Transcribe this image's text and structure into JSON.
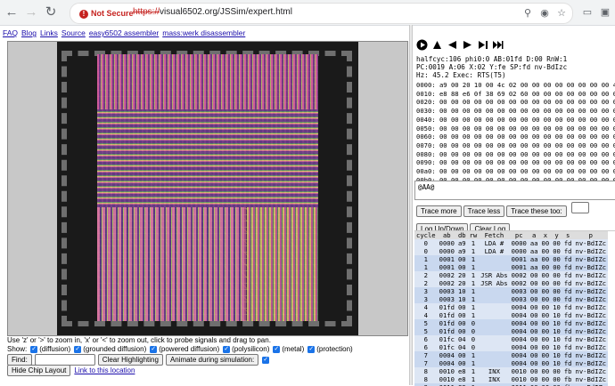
{
  "browser": {
    "security_label": "Not Secure",
    "url_scheme": "https://",
    "url_rest": "visual6502.org/JSSim/expert.html"
  },
  "top_links": [
    {
      "name": "link-faq",
      "label": "FAQ"
    },
    {
      "name": "link-blog",
      "label": "Blog"
    },
    {
      "name": "link-links",
      "label": "Links"
    },
    {
      "name": "link-source",
      "label": "Source"
    },
    {
      "name": "link-easy6502",
      "label": "easy6502 assembler"
    },
    {
      "name": "link-masswerk",
      "label": "mass:werk disassembler"
    }
  ],
  "instructions": "Use 'z' or '>' to zoom in, 'x' or '<' to zoom out, click to probe signals and drag to pan.",
  "show": {
    "label": "Show:",
    "options": [
      {
        "label": "(diffusion)",
        "checked": true
      },
      {
        "label": "(grounded diffusion)",
        "checked": true
      },
      {
        "label": "(powered diffusion)",
        "checked": true
      },
      {
        "label": "(polysilicon)",
        "checked": true
      },
      {
        "label": "(metal)",
        "checked": true
      },
      {
        "label": "(protection)",
        "checked": true
      }
    ]
  },
  "find_label": "Find:",
  "clear_highlighting_label": "Clear Highlighting",
  "animate_label": "Animate during simulation:",
  "hide_chip_label": "Hide Chip Layout",
  "link_location_label": "Link to this location",
  "status": {
    "line1": "halfcyc:106 phi0:0 AB:01fd D:00 RnW:1",
    "line2": "PC:0019 A:06 X:02 Y:fe SP:fd nv-BdIzc",
    "line3": "Hz: 45.2 Exec: RTS(T5)"
  },
  "memory": [
    "0000: a9 00 20 10 00 4c 02 00 00 00 00 00 00 00 00 42",
    "0010: e8 88 e6 0f 38 69 02 60 00 00 00 00 00 00 00 00",
    "0020: 00 00 00 00 00 00 00 00 00 00 00 00 00 00 00 00",
    "0030: 00 00 00 00 00 00 00 00 00 00 00 00 00 00 00 00",
    "0040: 00 00 00 00 00 00 00 00 00 00 00 00 00 00 00 00",
    "0050: 00 00 00 00 00 00 00 00 00 00 00 00 00 00 00 00",
    "0060: 00 00 00 00 00 00 00 00 00 00 00 00 00 00 00 00",
    "0070: 00 00 00 00 00 00 00 00 00 00 00 00 00 00 00 00",
    "0080: 00 00 00 00 00 00 00 00 00 00 00 00 00 00 00 00",
    "0090: 00 00 00 00 00 00 00 00 00 00 00 00 00 00 00 00",
    "00a0: 00 00 00 00 00 00 00 00 00 00 00 00 00 00 00 00",
    "00b0: 00 00 00 00 00 00 00 00 00 00 00 00 00 00 00 00"
  ],
  "console_text": "@AA@",
  "trace_buttons": [
    "Trace more",
    "Trace less",
    "Trace these too:",
    "Log Up/Down",
    "Clear Log"
  ],
  "trace_headers": [
    "cycle",
    "ab",
    "db",
    "rw",
    "Fetch",
    "pc",
    "a",
    "x",
    "y",
    "s",
    "p"
  ],
  "trace_rows": [
    [
      "0",
      "0000",
      "a9",
      "1",
      "LDA #",
      "0000",
      "aa",
      "00",
      "00",
      "fd",
      "nv-BdIZc"
    ],
    [
      "0",
      "0000",
      "a9",
      "1",
      "LDA #",
      "0000",
      "aa",
      "00",
      "00",
      "fd",
      "nv-BdIZc"
    ],
    [
      "1",
      "0001",
      "00",
      "1",
      "",
      "0001",
      "aa",
      "00",
      "00",
      "fd",
      "nv-BdIZc"
    ],
    [
      "1",
      "0001",
      "00",
      "1",
      "",
      "0001",
      "aa",
      "00",
      "00",
      "fd",
      "nv-BdIZc"
    ],
    [
      "2",
      "0002",
      "20",
      "1",
      "JSR Abs",
      "0002",
      "00",
      "00",
      "00",
      "fd",
      "nv-BdIZc"
    ],
    [
      "2",
      "0002",
      "20",
      "1",
      "JSR Abs",
      "0002",
      "00",
      "00",
      "00",
      "fd",
      "nv-BdIZc"
    ],
    [
      "3",
      "0003",
      "10",
      "1",
      "",
      "0003",
      "00",
      "00",
      "00",
      "fd",
      "nv-BdIZc"
    ],
    [
      "3",
      "0003",
      "10",
      "1",
      "",
      "0003",
      "00",
      "00",
      "00",
      "fd",
      "nv-BdIZc"
    ],
    [
      "4",
      "01fd",
      "00",
      "1",
      "",
      "0004",
      "00",
      "00",
      "10",
      "fd",
      "nv-BdIZc"
    ],
    [
      "4",
      "01fd",
      "00",
      "1",
      "",
      "0004",
      "00",
      "00",
      "10",
      "fd",
      "nv-BdIZc"
    ],
    [
      "5",
      "01fd",
      "00",
      "0",
      "",
      "0004",
      "00",
      "00",
      "10",
      "fd",
      "nv-BdIZc"
    ],
    [
      "5",
      "01fd",
      "00",
      "0",
      "",
      "0004",
      "00",
      "00",
      "10",
      "fd",
      "nv-BdIZc"
    ],
    [
      "6",
      "01fc",
      "04",
      "0",
      "",
      "0004",
      "00",
      "00",
      "10",
      "fd",
      "nv-BdIZc"
    ],
    [
      "6",
      "01fc",
      "04",
      "0",
      "",
      "0004",
      "00",
      "00",
      "10",
      "fd",
      "nv-BdIZc"
    ],
    [
      "7",
      "0004",
      "00",
      "1",
      "",
      "0004",
      "00",
      "00",
      "10",
      "fd",
      "nv-BdIZc"
    ],
    [
      "7",
      "0004",
      "00",
      "1",
      "",
      "0004",
      "00",
      "00",
      "10",
      "fd",
      "nv-BdIZc"
    ],
    [
      "8",
      "0010",
      "e8",
      "1",
      "INX",
      "0010",
      "00",
      "00",
      "00",
      "fb",
      "nv-BdIZc"
    ],
    [
      "8",
      "0010",
      "e8",
      "1",
      "INX",
      "0010",
      "00",
      "00",
      "00",
      "fb",
      "nv-BdIZc"
    ],
    [
      "9",
      "0011",
      "88",
      "1",
      "",
      "0011",
      "00",
      "00",
      "00",
      "fb",
      "nv-BdIZc"
    ]
  ]
}
